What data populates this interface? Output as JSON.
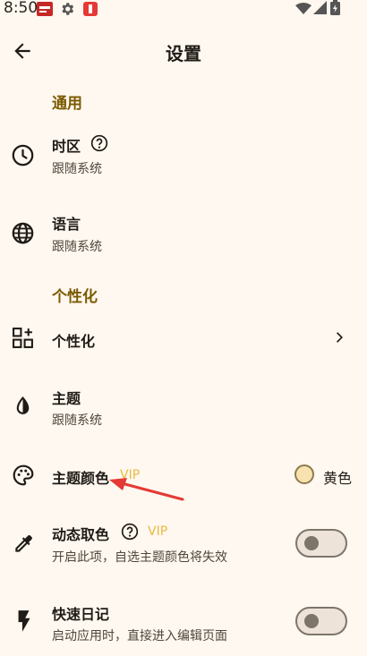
{
  "status_bar": {
    "time": "8:50"
  },
  "header": {
    "title": "设置"
  },
  "sections": {
    "general": "通用",
    "personalization": "个性化"
  },
  "items": {
    "timezone": {
      "title": "时区",
      "subtitle": "跟随系统"
    },
    "language": {
      "title": "语言",
      "subtitle": "跟随系统"
    },
    "personalize": {
      "title": "个性化"
    },
    "theme": {
      "title": "主题",
      "subtitle": "跟随系统"
    },
    "theme_color": {
      "title": "主题颜色",
      "vip": "VIP",
      "value": "黄色",
      "swatch": "#F8E3B0"
    },
    "dynamic_color": {
      "title": "动态取色",
      "vip": "VIP",
      "subtitle": "开启此项，自选主题颜色将失效",
      "enabled": false
    },
    "quick_diary": {
      "title": "快速日记",
      "subtitle": "启动应用时，直接进入编辑页面",
      "enabled": false
    }
  },
  "colors": {
    "accent": "#7A5A00",
    "vip": "#E8B940",
    "annotation_arrow": "#E53935"
  }
}
